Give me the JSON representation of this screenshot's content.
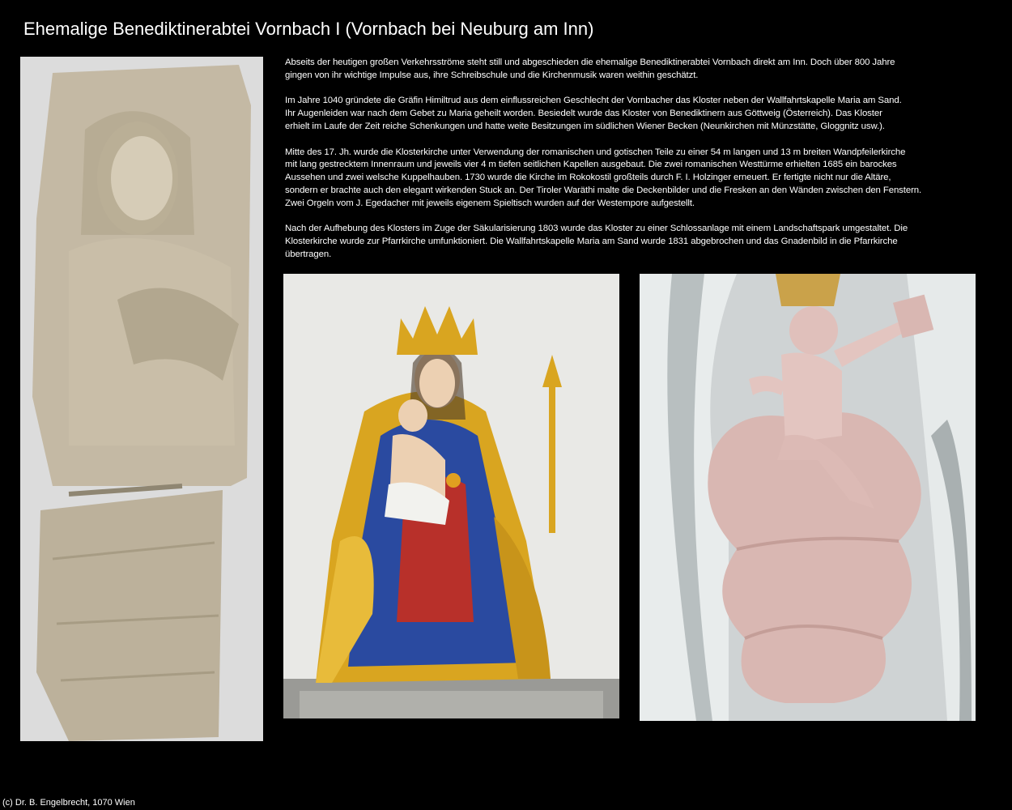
{
  "page": {
    "title": "Ehemalige Benediktinerabtei Vornbach I (Vornbach bei Neuburg am Inn)",
    "paragraphs": [
      "Abseits der heutigen großen Verkehrsströme steht still und abgeschieden die ehemalige Benediktinerabtei Vornbach direkt am Inn. Doch über 800 Jahre\ngingen von ihr wichtige Impulse aus, ihre Schreibschule und die Kirchenmusik waren weithin geschätzt.",
      "Im Jahre 1040 gründete die Gräfin Himiltrud aus dem einflussreichen Geschlecht der Vornbacher das Kloster neben der Wallfahrtskapelle Maria am Sand.\nIhr Augenleiden war nach dem Gebet zu Maria geheilt worden. Besiedelt wurde das Kloster von Benediktinern aus Göttweig (Österreich). Das Kloster\nerhielt im Laufe der Zeit reiche Schenkungen und hatte weite Besitzungen im südlichen Wiener Becken (Neunkirchen mit Münzstätte, Gloggnitz usw.).",
      "Mitte des 17. Jh. wurde die Klosterkirche unter Verwendung der romanischen und gotischen Teile zu einer 54 m langen und 13 m breiten Wandpfeilerkirche\nmit lang gestrecktem Innenraum und jeweils vier 4 m tiefen seitlichen Kapellen ausgebaut. Die zwei romanischen Westtürme erhielten 1685 ein barockes\nAussehen und zwei welsche Kuppelhauben. 1730 wurde die Kirche im Rokokostil großteils durch F. I. Holzinger erneuert. Er fertigte nicht nur die Altäre,\nsondern er brachte auch den elegant wirkenden Stuck an.  Der Tiroler Waräthi malte die Deckenbilder und die Fresken an den Wänden zwischen den Fenstern.\nZwei Orgeln vom J. Egedacher mit jeweils eigenem Spieltisch wurden auf der Westempore aufgestellt.",
      "Nach der Aufhebung des Klosters im Zuge der Säkularisierung 1803 wurde das Kloster zu einer Schlossanlage mit einem Landschaftspark umgestaltet. Die\nKlosterkirche wurde zur Pfarrkirche umfunktioniert. Die Wallfahrtskapelle Maria am Sand wurde 1831 abgebrochen und das Gnadenbild in die Pfarrkirche\nübertragen."
    ],
    "footer": "(c) Dr. B. Engelbrecht, 1070 Wien"
  },
  "photos": {
    "relief": "photo-stone-relief",
    "madonna": "photo-madonna-statue",
    "putto": "photo-putto-sculpture"
  },
  "colors": {
    "background": "#000000",
    "text": "#ffffff",
    "stone": "#c8bfae",
    "gold": "#d9a520",
    "blue": "#2a4aa0",
    "red": "#b8302a",
    "pink": "#d9b7b2"
  }
}
